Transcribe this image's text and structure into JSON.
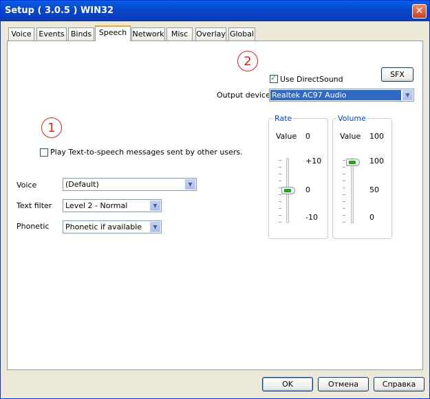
{
  "window": {
    "title": "Setup ( 3.0.5 ) WIN32",
    "close_label": "✕"
  },
  "tabs": [
    {
      "label": "Voice"
    },
    {
      "label": "Events"
    },
    {
      "label": "Binds"
    },
    {
      "label": "Speech",
      "active": true
    },
    {
      "label": "Network"
    },
    {
      "label": "Misc"
    },
    {
      "label": "Overlay"
    },
    {
      "label": "Global"
    }
  ],
  "annotations": {
    "one": "1",
    "two": "2"
  },
  "directsound": {
    "label": "Use DirectSound",
    "checked": true
  },
  "sfx_button": "SFX",
  "output_device": {
    "label": "Output device",
    "value": "Realtek AC97 Audio"
  },
  "tts": {
    "label": "Play Text-to-speech messages sent by other users.",
    "checked": false
  },
  "voice": {
    "label": "Voice",
    "value": "(Default)"
  },
  "text_filter": {
    "label": "Text filter",
    "value": "Level 2 - Normal"
  },
  "phonetic": {
    "label": "Phonetic",
    "value": "Phonetic if available"
  },
  "rate": {
    "title": "Rate",
    "value_label": "Value",
    "value": "0",
    "max": "+10",
    "mid": "0",
    "min": "-10"
  },
  "volume": {
    "title": "Volume",
    "value_label": "Value",
    "value": "100",
    "max": "100",
    "mid": "50",
    "min": "0"
  },
  "footer": {
    "ok": "OK",
    "cancel": "Отмена",
    "help": "Справка"
  },
  "colors": {
    "accent": "#316ac5",
    "annotation": "#e02020",
    "tab_highlight": "#f5a623",
    "title_bar": "#0a5fe8"
  }
}
